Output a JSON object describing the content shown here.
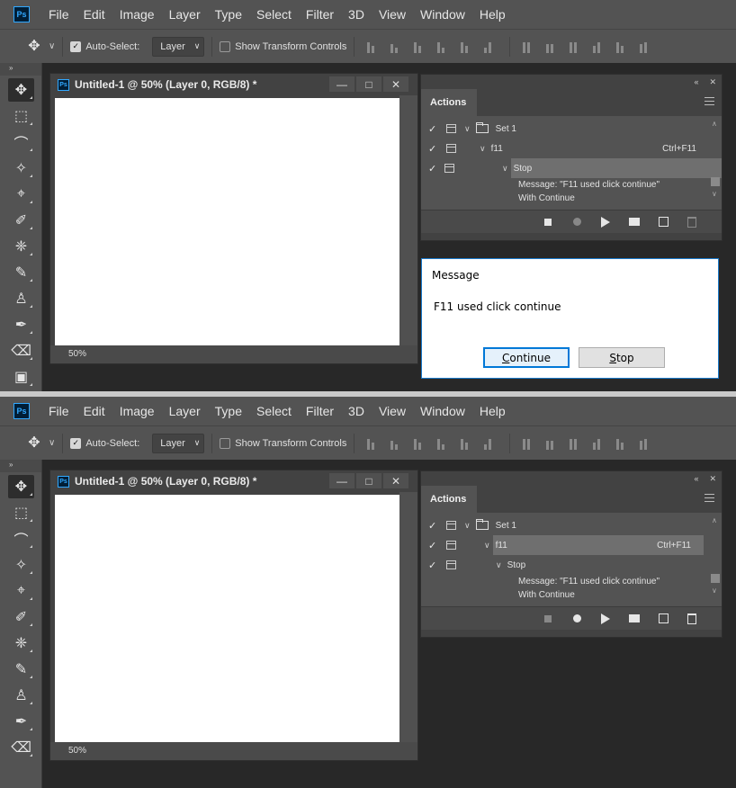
{
  "app": {
    "logo_text": "Ps",
    "menu": [
      "File",
      "Edit",
      "Image",
      "Layer",
      "Type",
      "Select",
      "Filter",
      "3D",
      "View",
      "Window",
      "Help"
    ]
  },
  "options": {
    "auto_select_label": "Auto-Select:",
    "auto_select_checked": true,
    "layer_dropdown_value": "Layer",
    "show_transform_label": "Show Transform Controls",
    "show_transform_checked": false
  },
  "document": {
    "title": "Untitled-1 @ 50% (Layer 0, RGB/8) *",
    "title_ps": "Ps",
    "zoom": "50%",
    "window_buttons": [
      "—",
      "□",
      "✕"
    ]
  },
  "actions_panel": {
    "tab_label": "Actions",
    "collapse_glyph": "«",
    "close_glyph": "✕",
    "set_name": "Set 1",
    "action_name": "f11",
    "action_shortcut": "Ctrl+F11",
    "step_name": "Stop",
    "step_message": "Message:  \"F11 used  click continue\"",
    "step_with_continue": "With Continue",
    "check_glyph": "✓",
    "chevron_glyph": "∨"
  },
  "top_screenshot": {
    "selected_row": "step"
  },
  "bottom_screenshot": {
    "selected_row": "action"
  },
  "dialog": {
    "title": "Message",
    "message": "F11 used  click continue",
    "continue_first": "C",
    "continue_rest": "ontinue",
    "stop_first": "S",
    "stop_rest": "top"
  },
  "colors": {
    "ps_blue": "#31a8ff",
    "panel_bg": "#535353",
    "dialog_accent": "#0078d7"
  }
}
